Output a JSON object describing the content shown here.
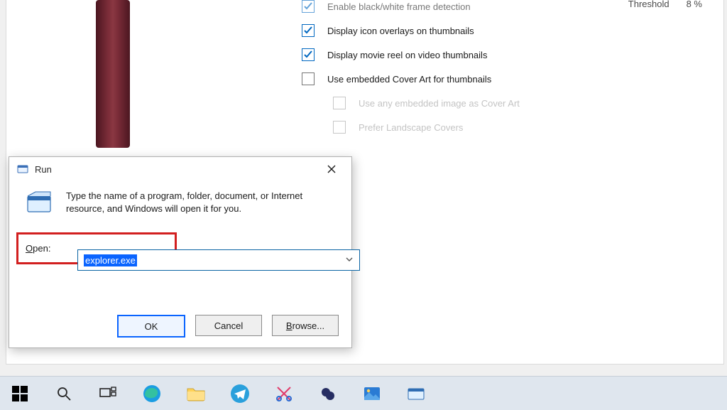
{
  "settings": {
    "rows": [
      {
        "checked": true,
        "label": "Enable black/white frame detection",
        "faded": true
      },
      {
        "checked": true,
        "label": "Display icon overlays on thumbnails"
      },
      {
        "checked": true,
        "label": "Display movie reel on video thumbnails"
      },
      {
        "checked": false,
        "label": "Use embedded Cover Art for thumbnails"
      },
      {
        "checked": false,
        "label": "Use any embedded image as Cover Art",
        "sub": true
      },
      {
        "checked": false,
        "label": "Prefer Landscape Covers",
        "sub": true
      }
    ],
    "threshold_label": "Threshold",
    "threshold_value": "8 %"
  },
  "run": {
    "title": "Run",
    "description": "Type the name of a program, folder, document, or Internet resource, and Windows will open it for you.",
    "open_label": "Open:",
    "open_value": "explorer.exe",
    "buttons": {
      "ok": "OK",
      "cancel": "Cancel",
      "browse": "Browse..."
    }
  },
  "taskbar": {
    "items": [
      "start",
      "search",
      "task-view",
      "edge",
      "file-explorer",
      "telegram",
      "snip",
      "icofx",
      "photos",
      "run-dialog"
    ]
  }
}
